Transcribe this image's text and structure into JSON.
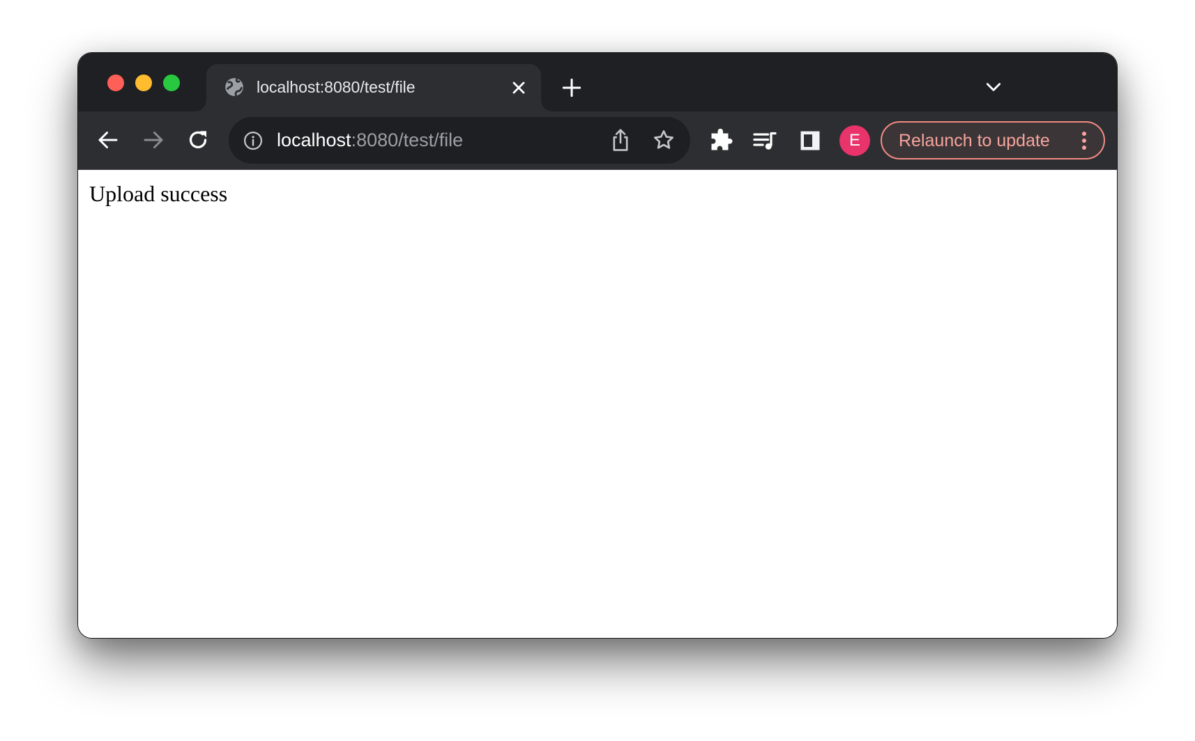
{
  "window": {
    "traffic_lights": [
      "close",
      "minimize",
      "zoom"
    ]
  },
  "tabs": [
    {
      "title": "localhost:8080/test/file",
      "icon": "globe-icon",
      "active": true
    }
  ],
  "tabstrip": {
    "new_tab_icon": "plus-icon",
    "tab_search_icon": "chevron-down-icon"
  },
  "toolbar": {
    "back_icon": "arrow-left-icon",
    "forward_icon": "arrow-right-icon",
    "reload_icon": "reload-icon",
    "omnibox": {
      "host": "localhost",
      "rest": ":8080/test/file",
      "info_icon": "info-icon",
      "share_icon": "share-icon",
      "bookmark_icon": "star-icon"
    },
    "extensions_icon": "puzzle-icon",
    "media_icon": "media-queue-icon",
    "side_panel_icon": "side-panel-icon",
    "profile_initial": "E",
    "relaunch_label": "Relaunch to update",
    "menu_icon": "kebab-menu-icon"
  },
  "page": {
    "message": "Upload success"
  },
  "colors": {
    "tabstrip_bg": "#1f2023",
    "toolbar_bg": "#2d2e32",
    "omnibox_bg": "#1e1f22",
    "avatar_bg": "#e8336b",
    "relaunch_accent": "#f28b82"
  }
}
